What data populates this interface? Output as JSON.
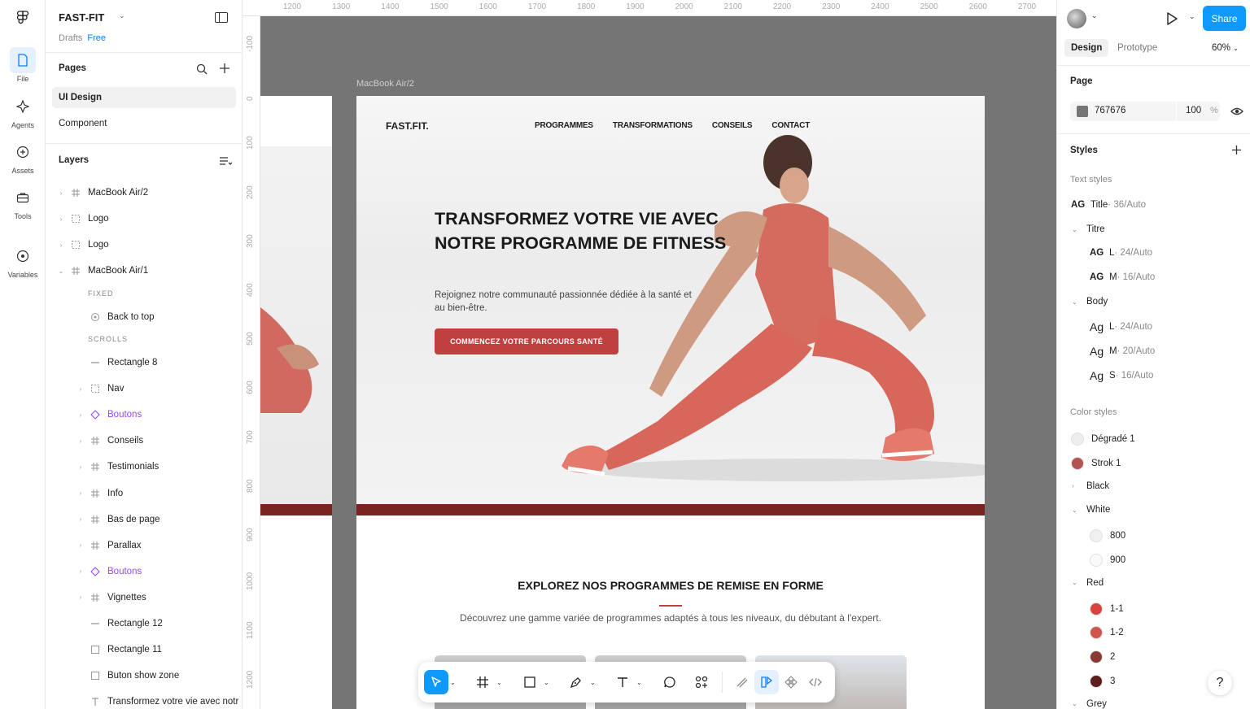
{
  "rail": {
    "items": [
      {
        "label": "File"
      },
      {
        "label": "Agents"
      },
      {
        "label": "Assets"
      },
      {
        "label": "Tools"
      },
      {
        "label": "Variables"
      }
    ]
  },
  "project": {
    "name": "FAST-FIT",
    "location": "Drafts",
    "plan": "Free"
  },
  "pages": {
    "title": "Pages",
    "items": [
      "UI Design",
      "Component"
    ]
  },
  "layers": {
    "title": "Layers",
    "items": [
      {
        "name": "MacBook Air/2",
        "icon": "frame-icon"
      },
      {
        "name": "Logo",
        "icon": "group-icon"
      },
      {
        "name": "Logo",
        "icon": "group-icon"
      },
      {
        "name": "MacBook Air/1",
        "icon": "frame-icon"
      }
    ],
    "fixed_label": "FIXED",
    "back_to_top": "Back to top",
    "scrolls_label": "SCROLLS",
    "children": [
      {
        "name": "Rectangle 8",
        "icon": "line-icon"
      },
      {
        "name": "Nav",
        "icon": "group-icon"
      },
      {
        "name": "Boutons",
        "icon": "component-icon"
      },
      {
        "name": "Conseils",
        "icon": "frame-icon"
      },
      {
        "name": "Testimonials",
        "icon": "frame-icon"
      },
      {
        "name": "Info",
        "icon": "frame-icon"
      },
      {
        "name": "Bas de page",
        "icon": "frame-icon"
      },
      {
        "name": "Parallax",
        "icon": "frame-icon"
      },
      {
        "name": "Boutons",
        "icon": "component-icon"
      },
      {
        "name": "Vignettes",
        "icon": "frame-icon"
      },
      {
        "name": "Rectangle 12",
        "icon": "line-icon"
      },
      {
        "name": "Rectangle 11",
        "icon": "rect-icon"
      },
      {
        "name": "Buton show zone",
        "icon": "rect-icon"
      },
      {
        "name": "Transformez votre vie avec notr",
        "icon": "text-icon"
      }
    ]
  },
  "canvas": {
    "ruler_top": [
      "1200",
      "1300",
      "1400",
      "1500",
      "1600",
      "1700",
      "1800",
      "1900",
      "2000",
      "2100",
      "2200",
      "2300",
      "2400",
      "2500",
      "2600",
      "2700"
    ],
    "ruler_left": [
      "-100",
      "0",
      "100",
      "200",
      "300",
      "400",
      "500",
      "600",
      "700",
      "800",
      "900",
      "1000",
      "1100",
      "1200"
    ],
    "frame_label": "MacBook Air/2"
  },
  "site": {
    "logo": "FAST.FIT.",
    "nav": [
      "PROGRAMMES",
      "TRANSFORMATIONS",
      "CONSEILS",
      "CONTACT"
    ],
    "headline": "TRANSFORMEZ VOTRE VIE AVEC NOTRE PROGRAMME DE FITNESS",
    "subtext": "Rejoignez notre communauté passionnée dédiée à la santé et au bien-être.",
    "cta": "COMMENCEZ VOTRE PARCOURS SANTÉ",
    "programs_title": "EXPLOREZ NOS PROGRAMMES DE REMISE EN FORME",
    "programs_desc": "Découvrez une gamme variée de programmes adaptés à tous les niveaux, du débutant à l'expert."
  },
  "right_panel": {
    "share": "Share",
    "tabs": [
      "Design",
      "Prototype"
    ],
    "zoom": "60%",
    "page_title": "Page",
    "page_color": "767676",
    "page_opacity": "100",
    "page_opacity_unit": "%",
    "styles_title": "Styles",
    "text_styles_title": "Text styles",
    "text_styles": [
      {
        "sample": "AG",
        "name": "Title",
        "meta": " · 36/Auto"
      },
      {
        "group": "Titre"
      },
      {
        "sample": "AG",
        "name": "L",
        "meta": " · 24/Auto"
      },
      {
        "sample": "AG",
        "name": "M",
        "meta": " · 16/Auto"
      },
      {
        "group": "Body"
      },
      {
        "sample": "Ag",
        "name": "L",
        "meta": " · 24/Auto"
      },
      {
        "sample": "Ag",
        "name": "M",
        "meta": " · 20/Auto"
      },
      {
        "sample": "Ag",
        "name": "S",
        "meta": " · 16/Auto"
      }
    ],
    "color_styles_title": "Color styles",
    "color_styles": [
      {
        "name": "Dégradé 1",
        "color": "#eeeeee"
      },
      {
        "name": "Strok 1",
        "color": "#b25451"
      },
      {
        "group": "Black"
      },
      {
        "group": "White"
      },
      {
        "name": "800",
        "color": "#f0f0f0"
      },
      {
        "name": "900",
        "color": "#fafafa"
      },
      {
        "group": "Red"
      },
      {
        "name": "1-1",
        "color": "#d9433f"
      },
      {
        "name": "1-2",
        "color": "#d0534e"
      },
      {
        "name": "2",
        "color": "#8a3a35"
      },
      {
        "name": "3",
        "color": "#5e1d1b"
      },
      {
        "group": "Grey"
      }
    ],
    "help": "?"
  },
  "colors": {
    "accent": "#0d99ff",
    "brand_red": "#c0403f",
    "canvas_bg": "#757575",
    "band": "#7a2421"
  }
}
